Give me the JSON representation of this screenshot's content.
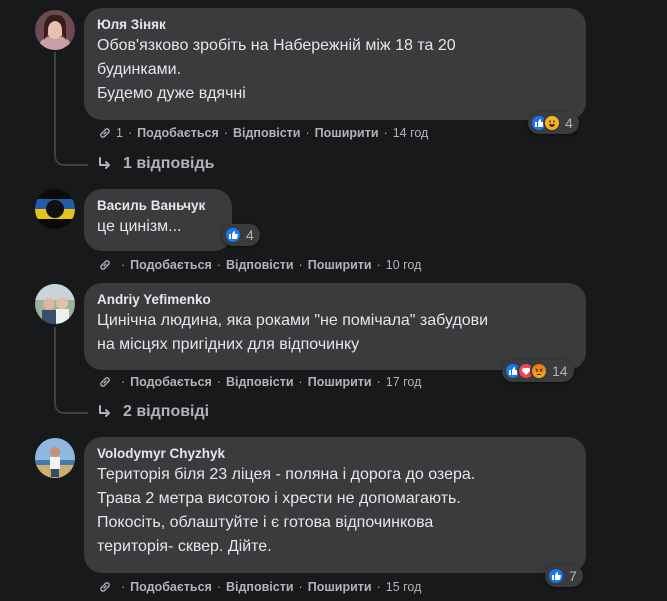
{
  "comments": [
    {
      "author": "Юля Зіняк",
      "lines": [
        "Обов'язково зробіть на Набережній між 18 та 20",
        "будинками.",
        "Будемо дуже вдячні"
      ],
      "link_count": "1",
      "like_label": "Подобається",
      "reply_label": "Відповісти",
      "share_label": "Поширити",
      "time": "14 год",
      "reactions": [
        "like-icon",
        "haha-icon"
      ],
      "reaction_count": "4",
      "replies": "1 відповідь"
    },
    {
      "author": "Василь Ваньчук",
      "lines": [
        "це цинізм..."
      ],
      "like_label": "Подобається",
      "reply_label": "Відповісти",
      "share_label": "Поширити",
      "time": "10 год",
      "reactions": [
        "like-icon"
      ],
      "reaction_count": "4"
    },
    {
      "author": "Andriy Yefimenko",
      "lines": [
        "Цинічна людина, яка роками \"не помічала\" забудови",
        "на місцях пригідних для відпочинку"
      ],
      "like_label": "Подобається",
      "reply_label": "Відповісти",
      "share_label": "Поширити",
      "time": "17 год",
      "reactions": [
        "like-icon",
        "love-icon",
        "angry-icon"
      ],
      "reaction_count": "14",
      "replies": "2 відповіді"
    },
    {
      "author": "Volodymyr Chyzhyk",
      "lines": [
        "Територія біля 23 ліцея - поляна і дорога до озера.",
        "Трава 2 метра висотою і хрести не допомагають.",
        "Покосіть, облаштуйте і є готова відпочинкова",
        "територія- сквер. Дійте."
      ],
      "like_label": "Подобається",
      "reply_label": "Відповісти",
      "share_label": "Поширити",
      "time": "15 год",
      "reactions": [
        "like-icon"
      ],
      "reaction_count": "7"
    }
  ],
  "separator": "·"
}
